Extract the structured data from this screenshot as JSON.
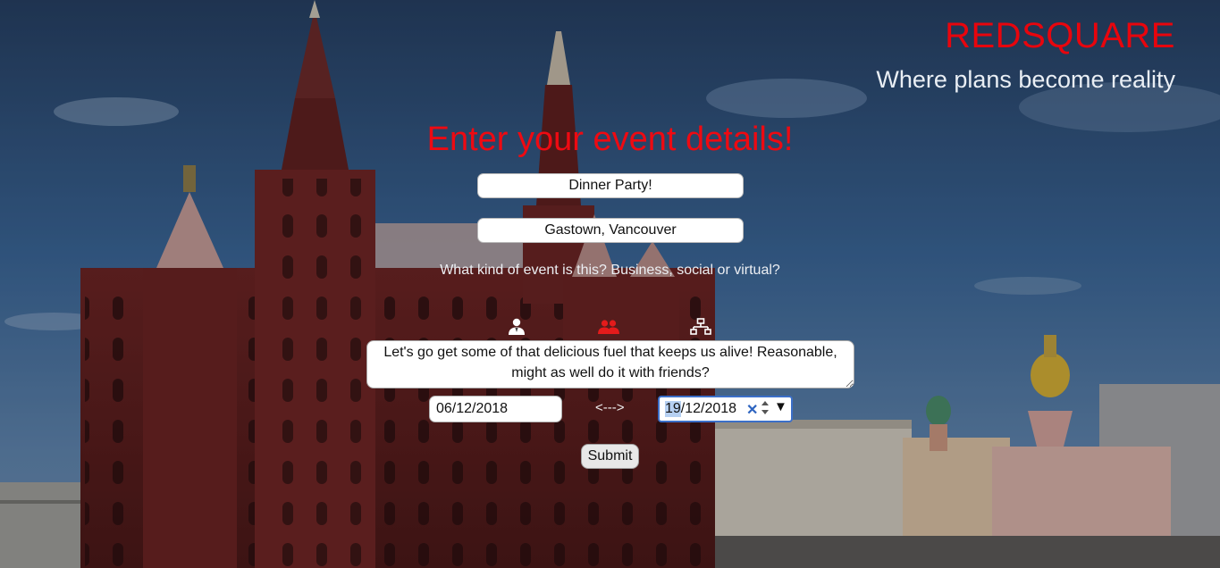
{
  "brand": {
    "title": "REDSQUARE",
    "tagline": "Where plans become reality"
  },
  "form": {
    "heading": "Enter your event details!",
    "event_name": "Dinner Party!",
    "event_location": "Gastown, Vancouver",
    "type_question": "What kind of event is this? Business, social or virtual?",
    "event_types": [
      {
        "name": "business",
        "icon": "person-icon",
        "selected": false
      },
      {
        "name": "social",
        "icon": "group-icon",
        "selected": true
      },
      {
        "name": "virtual",
        "icon": "network-icon",
        "selected": false
      }
    ],
    "description": "Let's go get some of that delicious fuel that keeps us alive! Reasonable, might as well do it with friends?",
    "start_date": "06/12/2018",
    "date_separator": "<--->",
    "end_date": {
      "day": "19",
      "rest": "/12/2018"
    },
    "submit_label": "Submit"
  },
  "colors": {
    "brand_red": "#e8050d",
    "selected_type": "#e31b1b",
    "sky": "#34598a",
    "building_red": "#7d2a2a"
  }
}
